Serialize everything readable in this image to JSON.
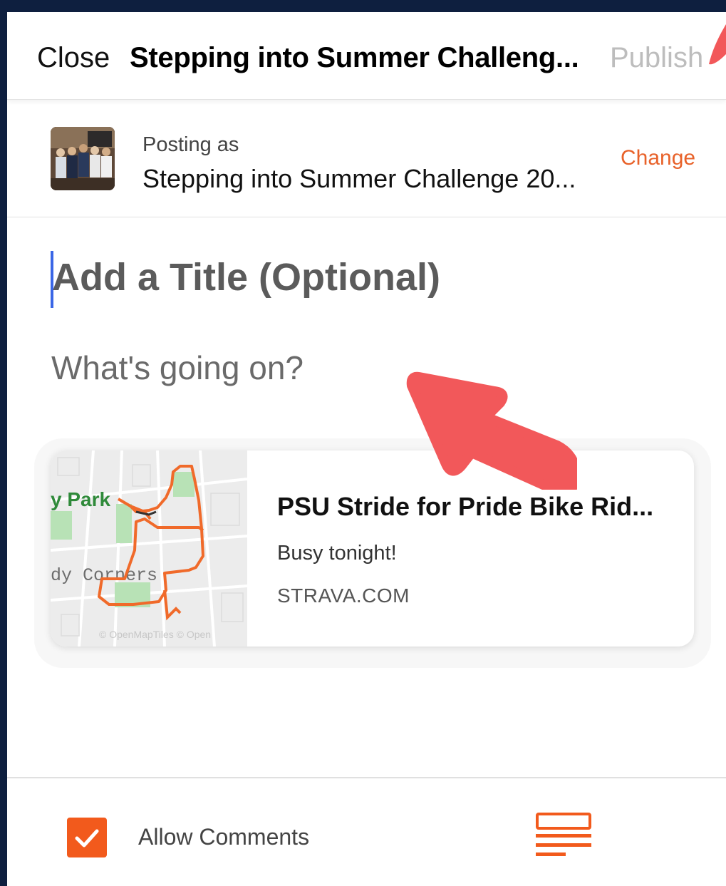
{
  "colors": {
    "accent": "#e8622a",
    "checkbox": "#f25a1c",
    "caret": "#3a66e6",
    "annotation_arrow": "#f2585a",
    "frame_background": "#0e1f3f"
  },
  "header": {
    "close_label": "Close",
    "title": "Stepping into Summer Challeng...",
    "publish_label": "Publish"
  },
  "posting_as": {
    "label": "Posting as",
    "name": "Stepping into Summer Challenge 20...",
    "change_label": "Change"
  },
  "composer": {
    "title_placeholder": "Add a Title (Optional)",
    "body_placeholder": "What's going on?"
  },
  "link_card": {
    "map_labels": [
      "y Park",
      "dy Corners",
      "© OpenMapTiles © Open"
    ],
    "title": "PSU Stride for Pride Bike Rid...",
    "description": "Busy tonight!",
    "domain": "STRAVA.COM"
  },
  "footer": {
    "allow_comments_label": "Allow Comments",
    "allow_comments_checked": true,
    "checkmark_icon": "checkmark-icon",
    "format_icon": "text-format-icon"
  }
}
